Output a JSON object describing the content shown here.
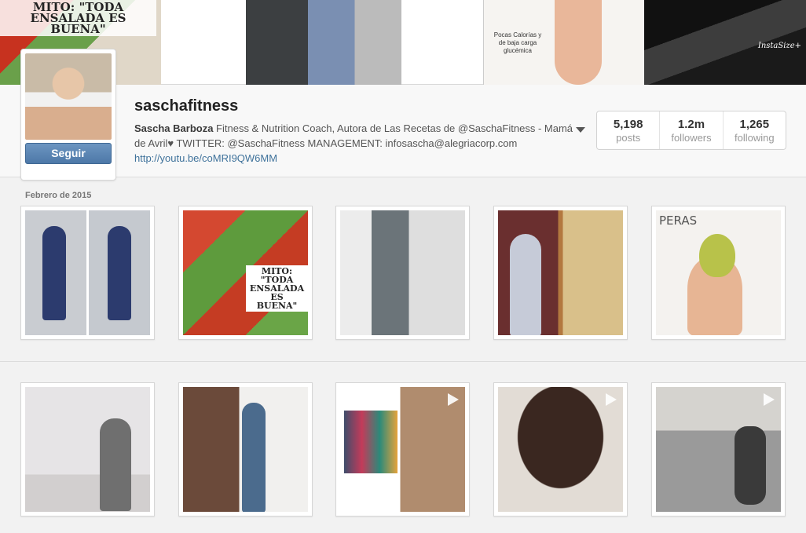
{
  "banner": {
    "tile1_text": "MITO: \"TODA ENSALADA ES BUENA\"",
    "tile3_caption": "Pocas Calorías y de baja carga glucémica",
    "tile4_watermark": "InstaSize+"
  },
  "profile": {
    "username": "saschafitness",
    "full_name": "Sascha Barboza",
    "bio_line": " Fitness & Nutrition Coach, Autora de Las Recetas de @SaschaFitness - Mamá de Avril♥ TWITTER: @SaschaFitness MANAGEMENT: infosascha@alegriacorp.com",
    "website": "http://youtu.be/coMRI9QW6MM",
    "follow_label": "Seguir",
    "stats": {
      "posts": {
        "value": "5,198",
        "label": "posts"
      },
      "followers": {
        "value": "1.2m",
        "label": "followers"
      },
      "following": {
        "value": "1,265",
        "label": "following"
      }
    }
  },
  "feed": {
    "month_label": "Febrero de 2015",
    "photo2_text": "MITO: \"TODA ENSALADA ES BUENA\"",
    "photo5_title": "PERAS"
  },
  "colors": {
    "accent": "#3f729b",
    "button": "#5a84b3"
  }
}
